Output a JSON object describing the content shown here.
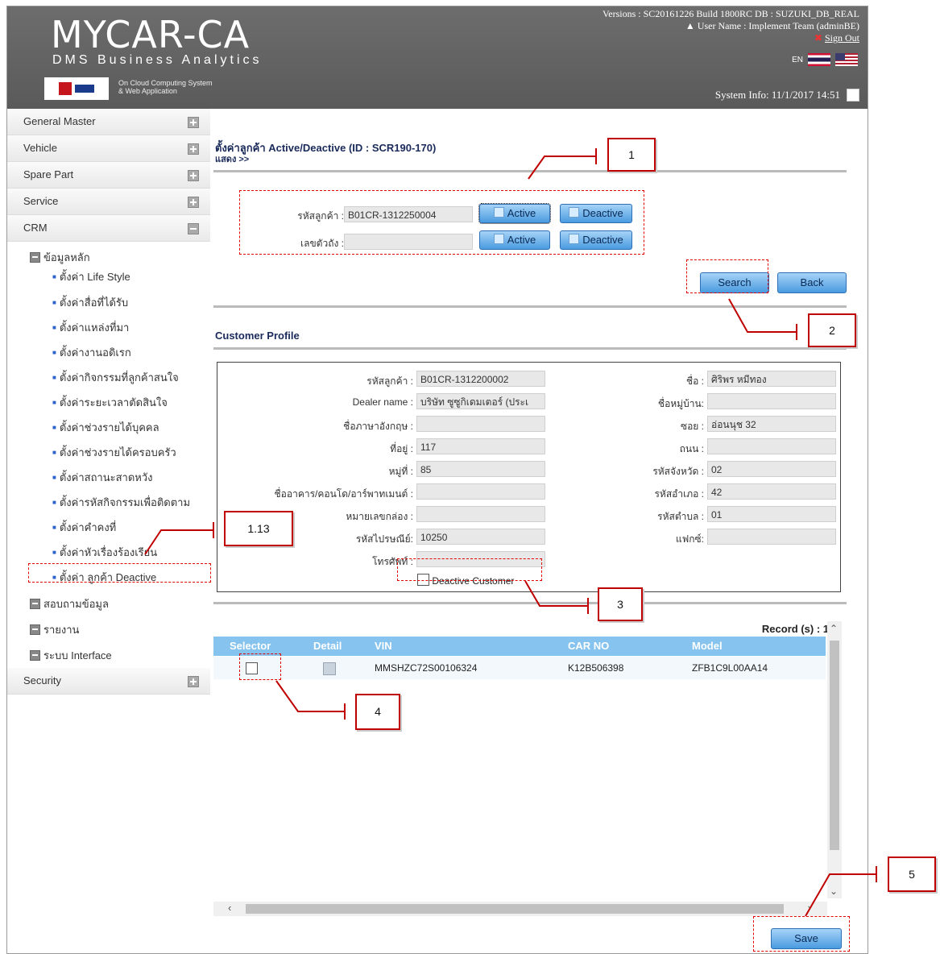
{
  "header": {
    "logo_title": "MYCAR-CA",
    "logo_subtitle": "DMS Business Analytics",
    "logo_cloud_line1": "On Cloud Computing System",
    "logo_cloud_line2": "& Web Application",
    "version": "Versions : SC20161226 Build 1800RC DB : SUZUKI_DB_REAL",
    "user": "User Name : Implement Team (adminBE)",
    "sign_out": "Sign Out",
    "lang": "EN",
    "system_info": "System Info: 11/1/2017 14:51"
  },
  "sidebar": {
    "menus": [
      "General Master",
      "Vehicle",
      "Spare Part",
      "Service",
      "CRM"
    ],
    "crm_root": "ข้อมูลหลัก",
    "crm_items": [
      "ตั้งค่า Life Style",
      "ตั้งค่าสื่อที่ได้รับ",
      "ตั้งค่าแหล่งที่มา",
      "ตั้งค่างานอดิเรก",
      "ตั้งค่ากิจกรรมที่ลูกค้าสนใจ",
      "ตั้งค่าระยะเวลาตัดสินใจ",
      "ตั้งค่าช่วงรายได้บุคคล",
      "ตั้งค่าช่วงรายได้ครอบครัว",
      "ตั้งค่าสถานะสาดหวัง",
      "ตั้งค่ารหัสกิจกรรมเพื่อติดตาม",
      "ตั้งค่าคำคงที่",
      "ตั้งค่าหัวเรื่องร้องเรียน",
      "ตั้งค่า ลูกค้า Deactive"
    ],
    "after_roots": [
      "สอบถามข้อมูล",
      "รายงาน",
      "ระบบ Interface"
    ],
    "security": "Security"
  },
  "main": {
    "title": "ตั้งค่าลูกค้า Active/Deactive (ID : SCR190-170)",
    "subtitle": "แสดง >>",
    "customer_code_label": "รหัสลูกค้า :",
    "customer_code_value": "B01CR-1312250004",
    "body_no_label": "เลขตัวถัง :",
    "body_no_value": "",
    "active_label": "Active",
    "deactive_label": "Deactive",
    "search_label": "Search",
    "back_label": "Back",
    "profile_title": "Customer Profile",
    "save_label": "Save"
  },
  "profile": {
    "left": [
      {
        "label": "รหัสลูกค้า :",
        "value": "B01CR-1312200002"
      },
      {
        "label": "Dealer name :",
        "value": "บริษัท ซูซูกิเดมเตอร์ (ประเ"
      },
      {
        "label": "ชื่อภาษาอังกฤษ :",
        "value": ""
      },
      {
        "label": "ที่อยู่ :",
        "value": "117"
      },
      {
        "label": "หมู่ที่ :",
        "value": "85"
      },
      {
        "label": "ชื่ออาคาร/คอนโด/อาร์พาทเมนต์ :",
        "value": ""
      },
      {
        "label": "หมายเลขกล่อง :",
        "value": ""
      },
      {
        "label": "รหัสไปรษณีย์:",
        "value": "10250"
      },
      {
        "label": "โทรศัพท์ :",
        "value": ""
      }
    ],
    "right": [
      {
        "label": "ชื่อ :",
        "value": "ศิริพร หมีทอง"
      },
      {
        "label": "ชื่อหมู่บ้าน:",
        "value": ""
      },
      {
        "label": "ซอย :",
        "value": "อ่อนนุช 32"
      },
      {
        "label": "ถนน :",
        "value": ""
      },
      {
        "label": "รหัสจังหวัด :",
        "value": "02"
      },
      {
        "label": "รหัสอำเภอ :",
        "value": "42"
      },
      {
        "label": "รหัสตำบล :",
        "value": "01"
      },
      {
        "label": "แฟกซ์:",
        "value": ""
      }
    ],
    "deactive_checkbox": "Deactive Customer"
  },
  "grid": {
    "record": "Record (s) : 1",
    "columns": [
      "Selector",
      "Detail",
      "VIN",
      "CAR NO",
      "Model"
    ],
    "rows": [
      {
        "vin": "MMSHZC72S00106324",
        "car_no": "K12B506398",
        "model": "ZFB1C9L00AA14"
      }
    ]
  },
  "annotations": [
    "1",
    "2",
    "3",
    "4",
    "5",
    "1.13"
  ]
}
